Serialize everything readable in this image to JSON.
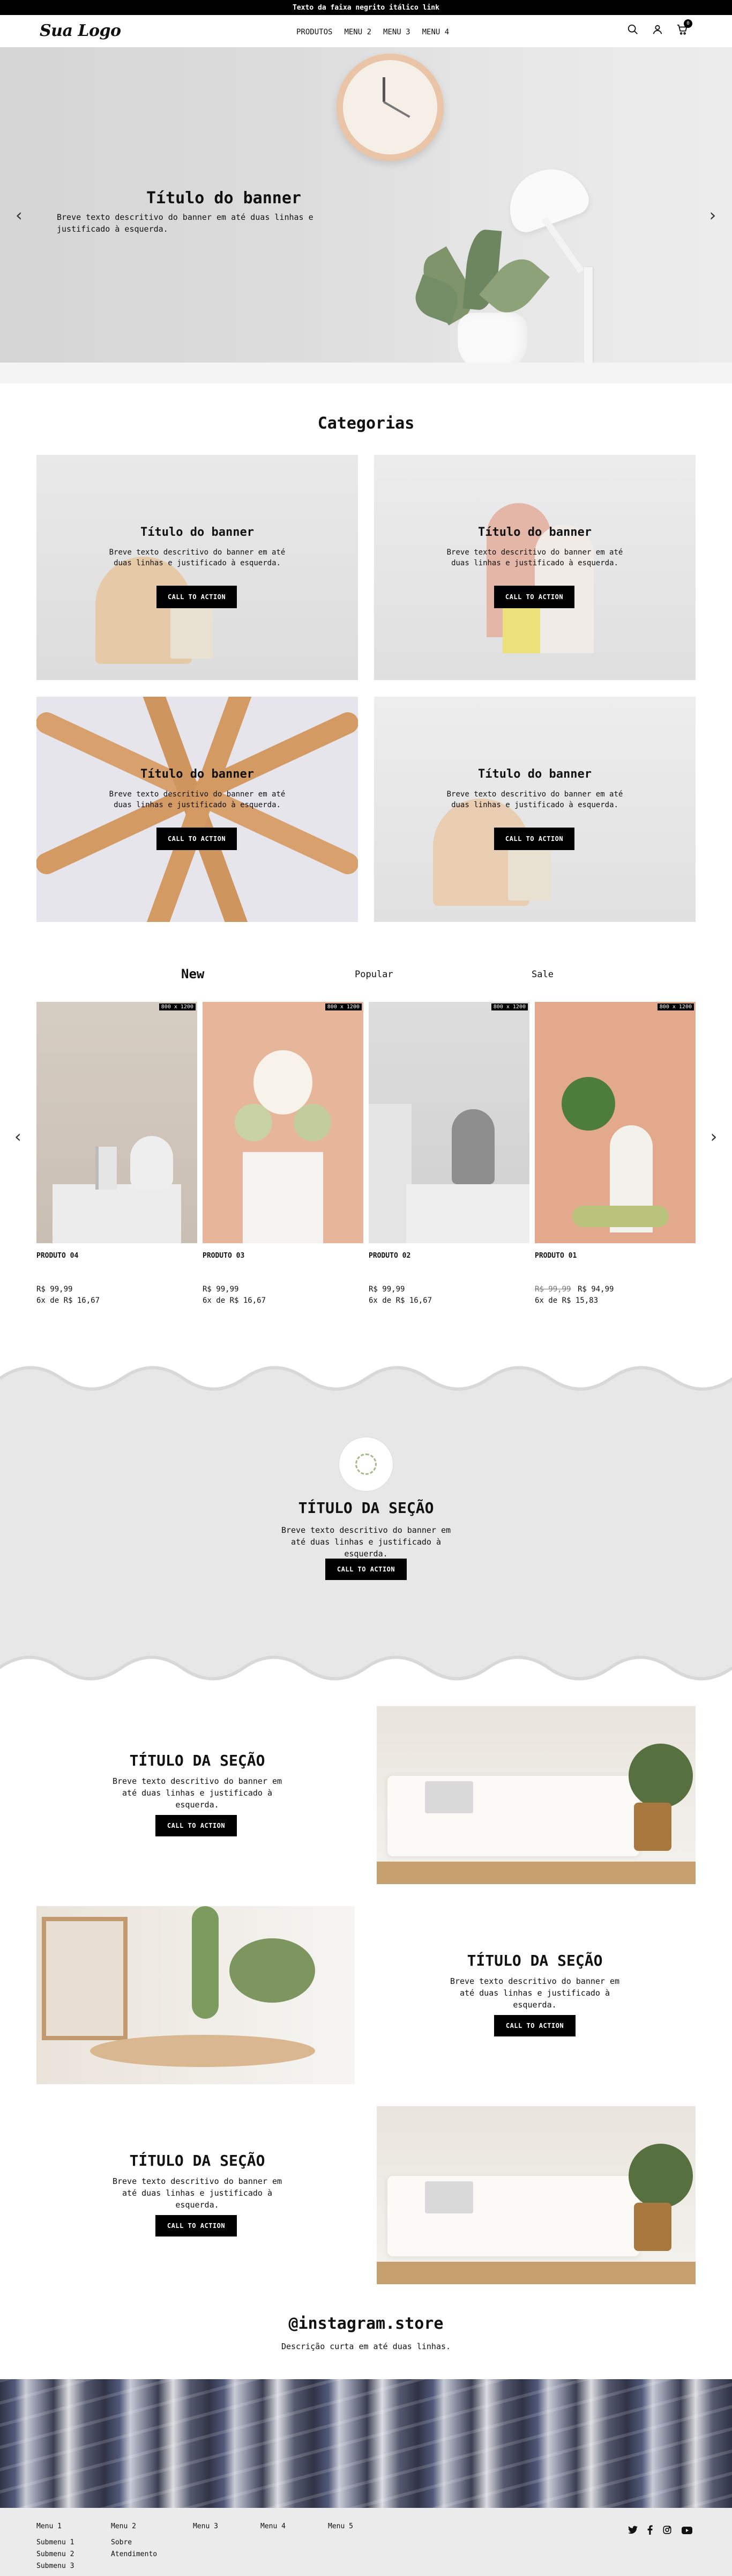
{
  "topbar": {
    "text": "Texto da faixa negrito itálico link"
  },
  "header": {
    "logo": "Sua Logo",
    "nav": [
      "PRODUTOS",
      "MENU 2",
      "MENU 3",
      "MENU 4"
    ],
    "cart_count": "0",
    "icons": [
      "search-icon",
      "user-icon",
      "cart-icon"
    ]
  },
  "hero": {
    "title": "Título do banner",
    "desc": "Breve texto descritivo do banner em até duas linhas e justificado à esquerda.",
    "prev": "‹",
    "next": "›"
  },
  "categories": {
    "title": "Categorias",
    "cards": [
      {
        "title": "Título do banner",
        "desc": "Breve texto descritivo do banner em até duas linhas e justificado à esquerda.",
        "cta": "CALL TO ACTION"
      },
      {
        "title": "Título do banner",
        "desc": "Breve texto descritivo do banner em até duas linhas e justificado à esquerda.",
        "cta": "CALL TO ACTION"
      },
      {
        "title": "Título do banner",
        "desc": "Breve texto descritivo do banner em até duas linhas e justificado à esquerda.",
        "cta": "CALL TO ACTION"
      },
      {
        "title": "Título do banner",
        "desc": "Breve texto descritivo do banner em até duas linhas e justificado à esquerda.",
        "cta": "CALL TO ACTION"
      }
    ]
  },
  "products": {
    "tabs": [
      "New",
      "Popular",
      "Sale"
    ],
    "items": [
      {
        "badge": "800 x 1200",
        "name": "PRODUTO 04",
        "price": "R$ 99,99",
        "old_price": "",
        "installments": "6x de R$ 16,67"
      },
      {
        "badge": "800 x 1200",
        "name": "PRODUTO 03",
        "price": "R$ 99,99",
        "old_price": "",
        "installments": "6x de R$ 16,67"
      },
      {
        "badge": "800 x 1200",
        "name": "PRODUTO 02",
        "price": "R$ 99,99",
        "old_price": "",
        "installments": "6x de R$ 16,67"
      },
      {
        "badge": "800 x 1200",
        "name": "PRODUTO 01",
        "price": "R$ 94,99",
        "old_price": "R$ 99,99",
        "installments": "6x de R$ 15,83"
      }
    ],
    "prev": "‹",
    "next": "›"
  },
  "highlight": {
    "title": "TÍTULO DA SEÇÃO",
    "desc": "Breve texto descritivo do banner em até duas linhas e justificado à esquerda.",
    "cta": "CALL TO ACTION"
  },
  "features": [
    {
      "title": "TÍTULO DA SEÇÃO",
      "desc": "Breve texto descritivo do banner em até duas linhas e justificado à esquerda.",
      "cta": "CALL TO ACTION"
    },
    {
      "title": "TÍTULO DA SEÇÃO",
      "desc": "Breve texto descritivo do banner em até duas linhas e justificado à esquerda.",
      "cta": "CALL TO ACTION"
    },
    {
      "title": "TÍTULO DA SEÇÃO",
      "desc": "Breve texto descritivo do banner em até duas linhas e justificado à esquerda.",
      "cta": "CALL TO ACTION"
    }
  ],
  "instagram": {
    "handle": "@instagram.store",
    "desc": "Descrição curta em até duas linhas."
  },
  "footer": {
    "cols": [
      {
        "title": "Menu 1",
        "items": [
          "Submenu 1",
          "Submenu 2",
          "Submenu 3"
        ]
      },
      {
        "title": "Menu 2",
        "items": [
          "Sobre",
          "Atendimento"
        ]
      },
      {
        "title": "Menu 3",
        "items": []
      },
      {
        "title": "Menu 4",
        "items": []
      },
      {
        "title": "Menu 5",
        "items": []
      }
    ],
    "social": [
      "twitter-icon",
      "facebook-icon",
      "instagram-icon",
      "youtube-icon"
    ]
  }
}
